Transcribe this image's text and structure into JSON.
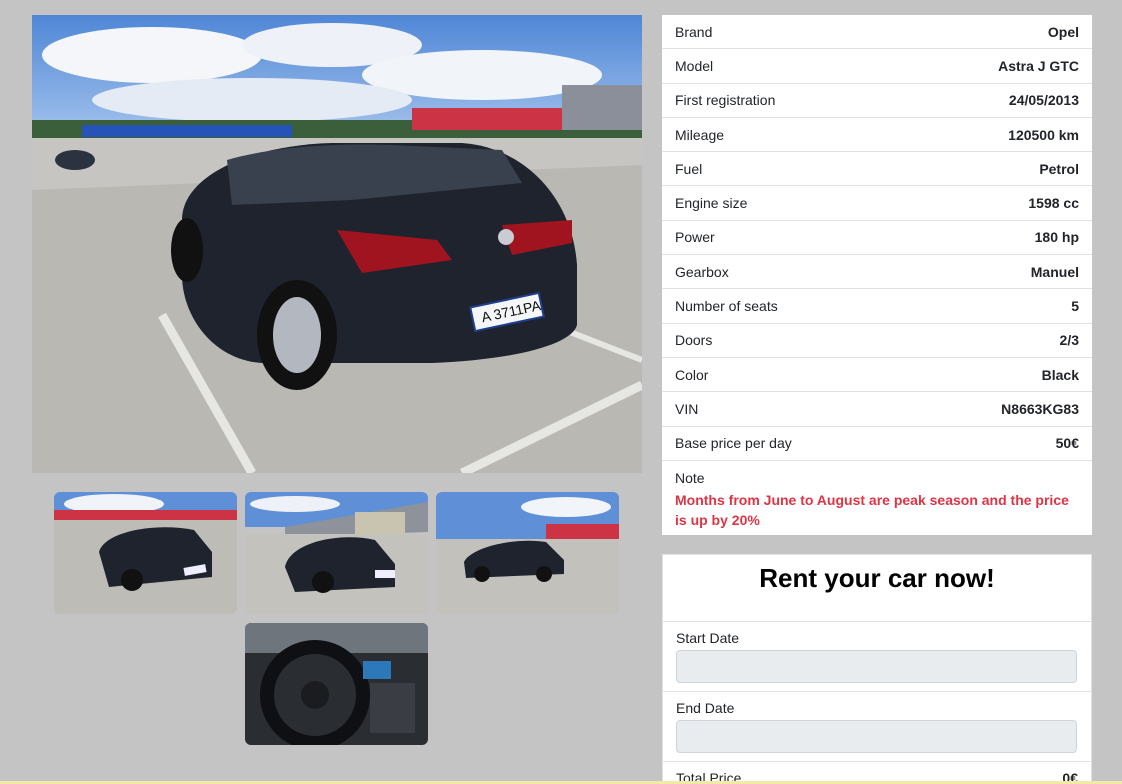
{
  "gallery": {
    "main_photo": "Black Opel Astra J GTC hatchback parked on a rooftop parking lot, rear three-quarter view",
    "plate_text": "A 3711PA",
    "thumbnails": [
      "rear-left view on parking lot",
      "front view near building",
      "side view on parking lot",
      "steering wheel and dashboard interior"
    ]
  },
  "specs": [
    {
      "label": "Brand",
      "value": "Opel"
    },
    {
      "label": "Model",
      "value": "Astra J GTC"
    },
    {
      "label": "First registration",
      "value": "24/05/2013"
    },
    {
      "label": "Mileage",
      "value": "120500 km"
    },
    {
      "label": "Fuel",
      "value": "Petrol"
    },
    {
      "label": "Engine size",
      "value": "1598 cc"
    },
    {
      "label": "Power",
      "value": "180 hp"
    },
    {
      "label": "Gearbox",
      "value": "Manuel"
    },
    {
      "label": "Number of seats",
      "value": "5"
    },
    {
      "label": "Doors",
      "value": "2/3"
    },
    {
      "label": "Color",
      "value": "Black"
    },
    {
      "label": "VIN",
      "value": "N8663KG83"
    },
    {
      "label": "Base price per day",
      "value": "50€"
    }
  ],
  "note": {
    "label": "Note",
    "text": "Months from June to August are peak season and the price is up by 20%"
  },
  "rent": {
    "title": "Rent your car now!",
    "start_label": "Start Date",
    "start_value": "",
    "end_label": "End Date",
    "end_value": "",
    "total_label": "Total Price",
    "total_value": "0€"
  },
  "colors": {
    "page_bg": "#c4c4c4",
    "note_red": "#dc3545",
    "input_bg": "#e9ecef"
  }
}
